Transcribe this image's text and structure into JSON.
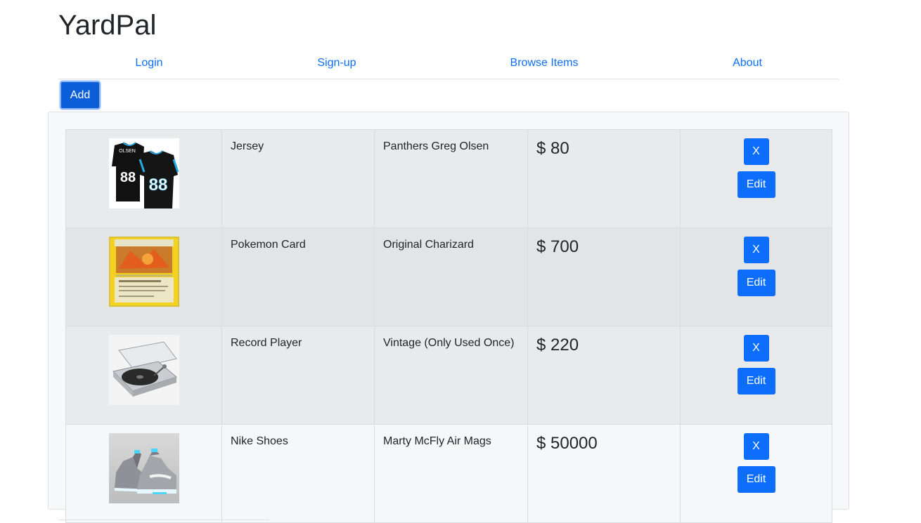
{
  "brand": "YardPal",
  "nav": {
    "login": "Login",
    "signup": "Sign-up",
    "browse": "Browse Items",
    "about": "About"
  },
  "add_label": "Add",
  "items": [
    {
      "name": "Jersey",
      "description": "Panthers Greg Olsen",
      "price": "$ 80",
      "image": "jersey-image",
      "delete_label": "X",
      "edit_label": "Edit"
    },
    {
      "name": "Pokemon Card",
      "description": "Original Charizard",
      "price": "$ 700",
      "image": "pokemon-card-image",
      "delete_label": "X",
      "edit_label": "Edit"
    },
    {
      "name": "Record Player",
      "description": "Vintage (Only Used Once)",
      "price": "$ 220",
      "image": "record-player-image",
      "delete_label": "X",
      "edit_label": "Edit"
    },
    {
      "name": "Nike Shoes",
      "description": "Marty McFly Air Mags",
      "price": "$ 50000",
      "image": "nike-shoes-image",
      "delete_label": "X",
      "edit_label": "Edit"
    }
  ],
  "colors": {
    "primary": "#0d6efd",
    "link": "#0d6efd",
    "panel": "#f7f8fa",
    "stripe": "#e9eaec"
  }
}
